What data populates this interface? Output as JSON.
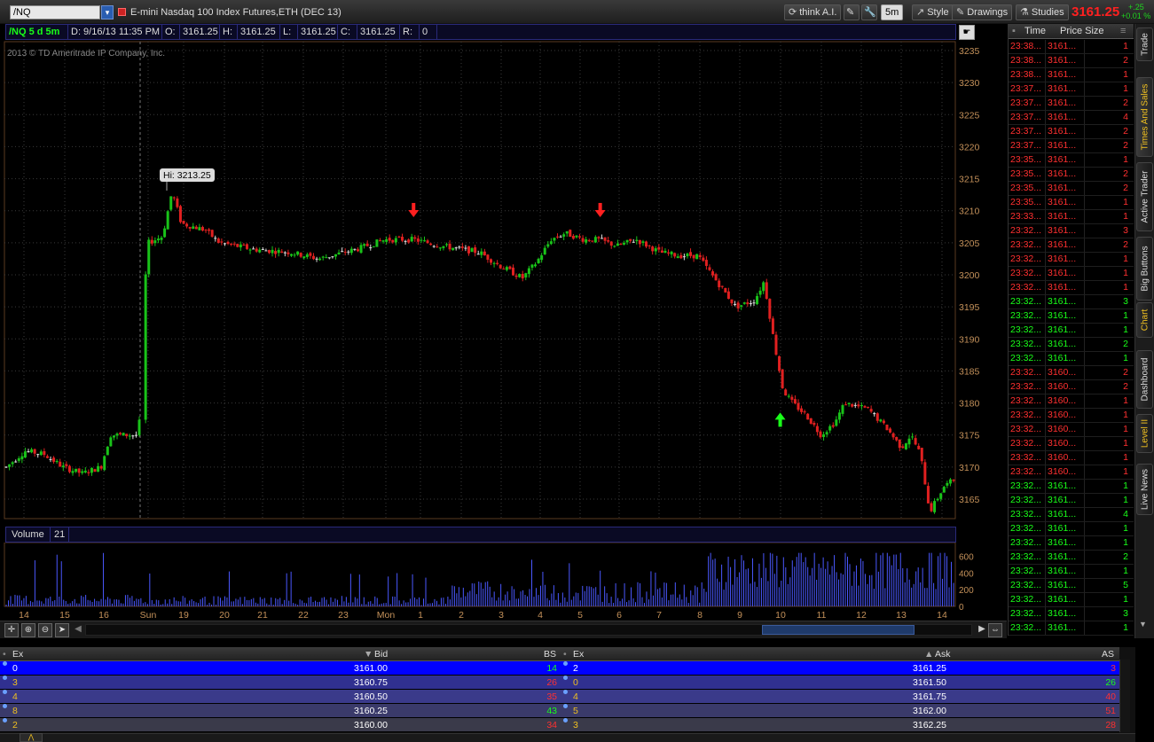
{
  "toolbar": {
    "symbol": "/NQ",
    "description": "E-mini Nasdaq 100 Index Futures,ETH (DEC 13)",
    "think_label": "think A.I.",
    "interval_label": "5m",
    "style_label": "Style",
    "drawings_label": "Drawings",
    "studies_label": "Studies",
    "last_price": "3161.25",
    "change_points": "+.25",
    "change_percent": "+0.01 %",
    "price_color": "#ff2020",
    "change_color": "#1fd51f"
  },
  "chart_header": {
    "symbol_period": "/NQ 5 d 5m",
    "date": "D: 9/16/13 11:35 PM",
    "open_label": "O:",
    "open": "3161.25",
    "high_label": "H:",
    "high": "3161.25",
    "low_label": "L:",
    "low": "3161.25",
    "close_label": "C:",
    "close": "3161.25",
    "range_label": "R:",
    "range": "0"
  },
  "copyright": "2013 © TD Ameritrade IP Company, Inc.",
  "high_callout": "Hi: 3213.25",
  "volume_header": {
    "label": "Volume",
    "value": "21"
  },
  "chart_data": {
    "type": "candlestick",
    "y_ticks": [
      3235,
      3230,
      3225,
      3220,
      3215,
      3210,
      3205,
      3200,
      3195,
      3190,
      3185,
      3180,
      3175,
      3170,
      3165
    ],
    "x_ticks": [
      "14",
      "15",
      "16",
      "Sun",
      "19",
      "20",
      "21",
      "22",
      "23",
      "Mon",
      "1",
      "2",
      "3",
      "4",
      "5",
      "6",
      "7",
      "8",
      "9",
      "10",
      "11",
      "12",
      "13",
      "14"
    ],
    "volume_ticks": [
      600,
      400,
      200,
      0
    ],
    "high_value": 3213.25,
    "price_path": [
      [
        0,
        3170
      ],
      [
        0.02,
        3172.5
      ],
      [
        0.04,
        3172
      ],
      [
        0.06,
        3170
      ],
      [
        0.08,
        3169
      ],
      [
        0.1,
        3170
      ],
      [
        0.11,
        3175
      ],
      [
        0.125,
        3175
      ],
      [
        0.14,
        3175
      ],
      [
        0.145,
        3196
      ],
      [
        0.15,
        3205
      ],
      [
        0.165,
        3206
      ],
      [
        0.175,
        3213
      ],
      [
        0.185,
        3208
      ],
      [
        0.21,
        3207
      ],
      [
        0.225,
        3205
      ],
      [
        0.26,
        3204
      ],
      [
        0.3,
        3203.5
      ],
      [
        0.33,
        3202.5
      ],
      [
        0.37,
        3204
      ],
      [
        0.4,
        3205.5
      ],
      [
        0.43,
        3205.5
      ],
      [
        0.46,
        3204.5
      ],
      [
        0.5,
        3203.5
      ],
      [
        0.52,
        3201.5
      ],
      [
        0.545,
        3199.5
      ],
      [
        0.56,
        3202
      ],
      [
        0.575,
        3205.5
      ],
      [
        0.59,
        3206.5
      ],
      [
        0.61,
        3205.5
      ],
      [
        0.625,
        3205.5
      ],
      [
        0.645,
        3204.5
      ],
      [
        0.665,
        3205.5
      ],
      [
        0.69,
        3203.5
      ],
      [
        0.71,
        3203
      ],
      [
        0.73,
        3203
      ],
      [
        0.75,
        3199
      ],
      [
        0.77,
        3195
      ],
      [
        0.79,
        3196
      ],
      [
        0.8,
        3199
      ],
      [
        0.81,
        3190
      ],
      [
        0.82,
        3182
      ],
      [
        0.83,
        3180
      ],
      [
        0.845,
        3178
      ],
      [
        0.86,
        3175
      ],
      [
        0.875,
        3177
      ],
      [
        0.885,
        3180
      ],
      [
        0.91,
        3179
      ],
      [
        0.93,
        3176
      ],
      [
        0.945,
        3173
      ],
      [
        0.955,
        3175
      ],
      [
        0.965,
        3172
      ],
      [
        0.975,
        3163
      ],
      [
        0.99,
        3167
      ],
      [
        1,
        3168
      ]
    ],
    "markers": [
      {
        "type": "down-arrow",
        "color": "#ff2020",
        "x": 0.43,
        "y": 3209
      },
      {
        "type": "down-arrow",
        "color": "#ff2020",
        "x": 0.627,
        "y": 3209
      },
      {
        "type": "up-arrow",
        "color": "#19ff19",
        "x": 0.817,
        "y": 3178.5
      }
    ],
    "colors": {
      "up": "#19c219",
      "down": "#e02020",
      "axis_text": "#c4915a",
      "grid": "#3a3a3a",
      "volume": "#4a58ff"
    }
  },
  "times_sales": {
    "headers": {
      "time": "Time",
      "price_size": "Price Size"
    },
    "rows": [
      {
        "time": "23:38...",
        "price": "3161...",
        "size": "1",
        "color": "#ff3030"
      },
      {
        "time": "23:38...",
        "price": "3161...",
        "size": "2",
        "color": "#ff3030"
      },
      {
        "time": "23:38...",
        "price": "3161...",
        "size": "1",
        "color": "#ff3030"
      },
      {
        "time": "23:37...",
        "price": "3161...",
        "size": "1",
        "color": "#ff3030"
      },
      {
        "time": "23:37...",
        "price": "3161...",
        "size": "2",
        "color": "#ff3030"
      },
      {
        "time": "23:37...",
        "price": "3161...",
        "size": "4",
        "color": "#ff3030"
      },
      {
        "time": "23:37...",
        "price": "3161...",
        "size": "2",
        "color": "#ff3030"
      },
      {
        "time": "23:37...",
        "price": "3161...",
        "size": "2",
        "color": "#ff3030"
      },
      {
        "time": "23:35...",
        "price": "3161...",
        "size": "1",
        "color": "#ff3030"
      },
      {
        "time": "23:35...",
        "price": "3161...",
        "size": "2",
        "color": "#ff3030"
      },
      {
        "time": "23:35...",
        "price": "3161...",
        "size": "2",
        "color": "#ff3030"
      },
      {
        "time": "23:35...",
        "price": "3161...",
        "size": "1",
        "color": "#ff3030"
      },
      {
        "time": "23:33...",
        "price": "3161...",
        "size": "1",
        "color": "#ff3030"
      },
      {
        "time": "23:32...",
        "price": "3161...",
        "size": "3",
        "color": "#ff3030"
      },
      {
        "time": "23:32...",
        "price": "3161...",
        "size": "2",
        "color": "#ff3030"
      },
      {
        "time": "23:32...",
        "price": "3161...",
        "size": "1",
        "color": "#ff3030"
      },
      {
        "time": "23:32...",
        "price": "3161...",
        "size": "1",
        "color": "#ff3030"
      },
      {
        "time": "23:32...",
        "price": "3161...",
        "size": "1",
        "color": "#ff3030"
      },
      {
        "time": "23:32...",
        "price": "3161...",
        "size": "3",
        "color": "#19ff19"
      },
      {
        "time": "23:32...",
        "price": "3161...",
        "size": "1",
        "color": "#19ff19"
      },
      {
        "time": "23:32...",
        "price": "3161...",
        "size": "1",
        "color": "#19ff19"
      },
      {
        "time": "23:32...",
        "price": "3161...",
        "size": "2",
        "color": "#19ff19"
      },
      {
        "time": "23:32...",
        "price": "3161...",
        "size": "1",
        "color": "#19ff19"
      },
      {
        "time": "23:32...",
        "price": "3160...",
        "size": "2",
        "color": "#ff3030"
      },
      {
        "time": "23:32...",
        "price": "3160...",
        "size": "2",
        "color": "#ff3030"
      },
      {
        "time": "23:32...",
        "price": "3160...",
        "size": "1",
        "color": "#ff3030"
      },
      {
        "time": "23:32...",
        "price": "3160...",
        "size": "1",
        "color": "#ff3030"
      },
      {
        "time": "23:32...",
        "price": "3160...",
        "size": "1",
        "color": "#ff3030"
      },
      {
        "time": "23:32...",
        "price": "3160...",
        "size": "1",
        "color": "#ff3030"
      },
      {
        "time": "23:32...",
        "price": "3160...",
        "size": "1",
        "color": "#ff3030"
      },
      {
        "time": "23:32...",
        "price": "3160...",
        "size": "1",
        "color": "#ff3030"
      },
      {
        "time": "23:32...",
        "price": "3161...",
        "size": "1",
        "color": "#19ff19"
      },
      {
        "time": "23:32...",
        "price": "3161...",
        "size": "1",
        "color": "#19ff19"
      },
      {
        "time": "23:32...",
        "price": "3161...",
        "size": "4",
        "color": "#19ff19"
      },
      {
        "time": "23:32...",
        "price": "3161...",
        "size": "1",
        "color": "#19ff19"
      },
      {
        "time": "23:32...",
        "price": "3161...",
        "size": "1",
        "color": "#19ff19"
      },
      {
        "time": "23:32...",
        "price": "3161...",
        "size": "2",
        "color": "#19ff19"
      },
      {
        "time": "23:32...",
        "price": "3161...",
        "size": "1",
        "color": "#19ff19"
      },
      {
        "time": "23:32...",
        "price": "3161...",
        "size": "5",
        "color": "#19ff19"
      },
      {
        "time": "23:32...",
        "price": "3161...",
        "size": "1",
        "color": "#19ff19"
      },
      {
        "time": "23:32...",
        "price": "3161...",
        "size": "3",
        "color": "#19ff19"
      },
      {
        "time": "23:32...",
        "price": "3161...",
        "size": "1",
        "color": "#19ff19"
      }
    ]
  },
  "side_tabs": [
    "Trade",
    "Times And Sales",
    "Active Trader",
    "Big Buttons",
    "Chart",
    "Dashboard",
    "Level II",
    "Live News"
  ],
  "level2": {
    "bid_headers": {
      "ex": "Ex",
      "bid": "Bid",
      "size": "BS"
    },
    "ask_headers": {
      "ex": "Ex",
      "ask": "Ask",
      "size": "AS"
    },
    "bids": [
      {
        "ex": "0",
        "price": "3161.00",
        "size": "14",
        "size_color": "#19ff19",
        "bg": "#0000ff"
      },
      {
        "ex": "3",
        "price": "3160.75",
        "size": "26",
        "size_color": "#ff3030",
        "bg": "#303090"
      },
      {
        "ex": "4",
        "price": "3160.50",
        "size": "35",
        "size_color": "#ff3030",
        "bg": "#3a3a8a"
      },
      {
        "ex": "8",
        "price": "3160.25",
        "size": "43",
        "size_color": "#19ff19",
        "bg": "#3a3a6a"
      },
      {
        "ex": "2",
        "price": "3160.00",
        "size": "34",
        "size_color": "#ff3030",
        "bg": "#3a3a4a"
      }
    ],
    "asks": [
      {
        "ex": "2",
        "price": "3161.25",
        "size": "3",
        "size_color": "#ff3030",
        "bg": "#0000ff"
      },
      {
        "ex": "0",
        "price": "3161.50",
        "size": "26",
        "size_color": "#19ff19",
        "bg": "#303090"
      },
      {
        "ex": "4",
        "price": "3161.75",
        "size": "40",
        "size_color": "#ff3030",
        "bg": "#3a3a8a"
      },
      {
        "ex": "5",
        "price": "3162.00",
        "size": "51",
        "size_color": "#ff3030",
        "bg": "#3a3a6a"
      },
      {
        "ex": "3",
        "price": "3162.25",
        "size": "28",
        "size_color": "#ff3030",
        "bg": "#3a3a4a"
      }
    ]
  }
}
